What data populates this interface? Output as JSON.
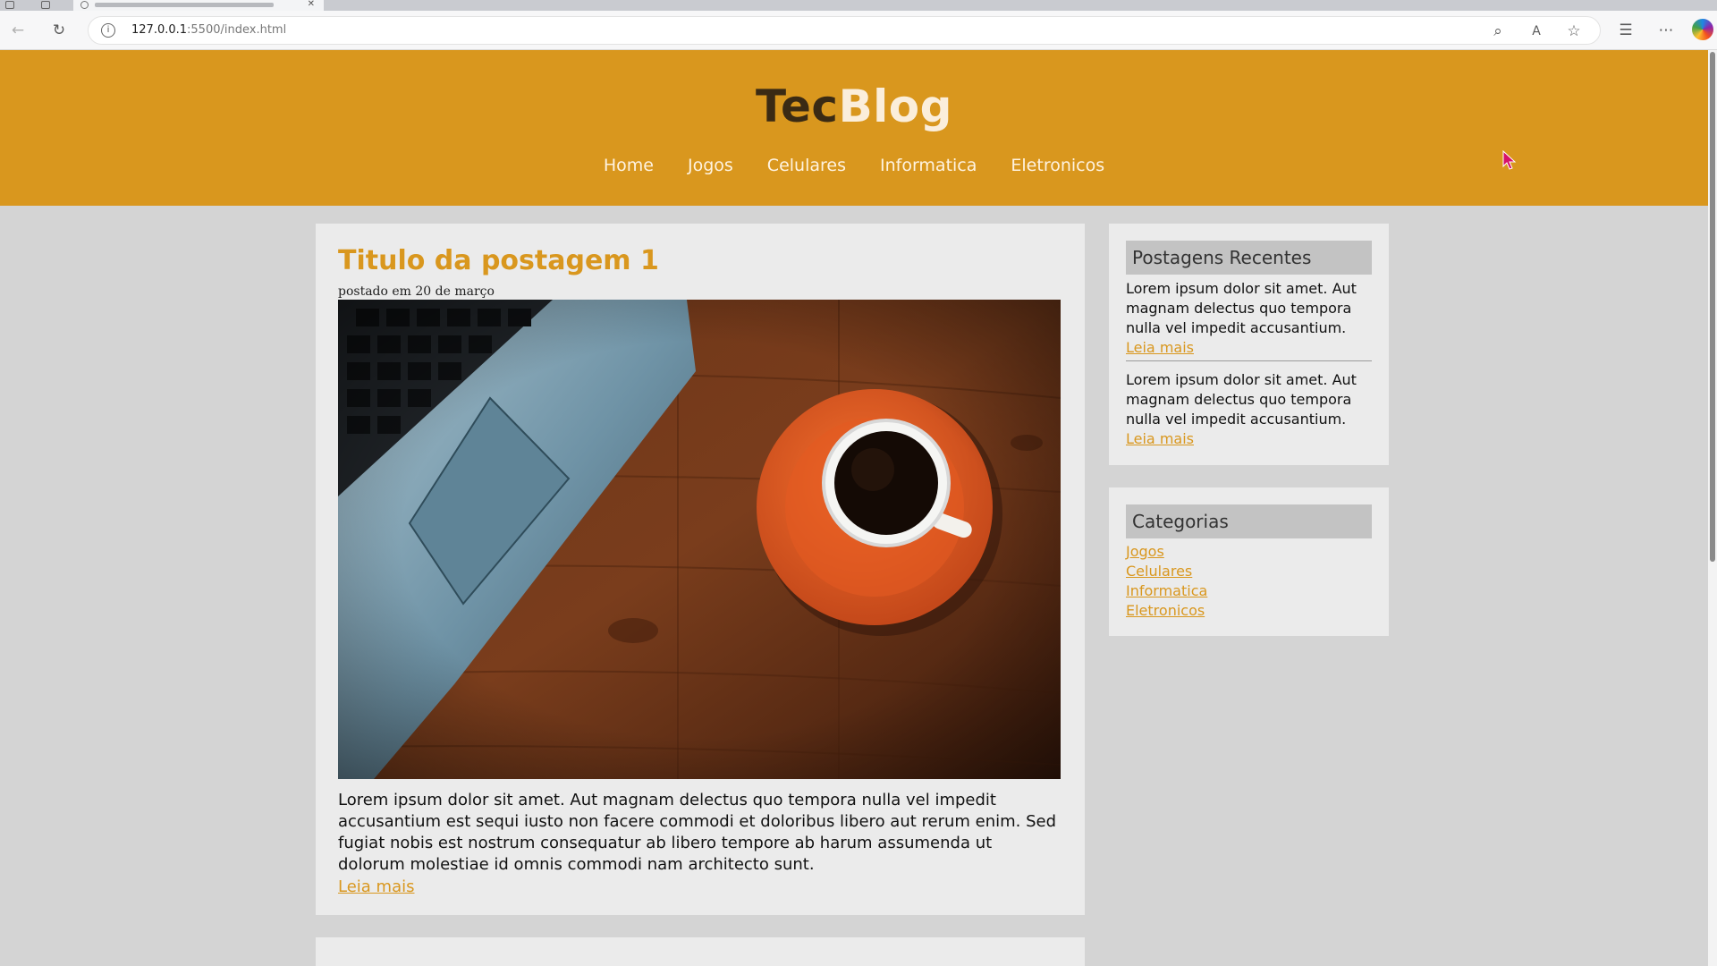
{
  "browser": {
    "url_host": "127.0.0.1",
    "url_path": ":5500/index.html",
    "back_icon": "arrow-left-icon",
    "reload_icon": "reload-icon"
  },
  "site": {
    "logo_part1": "Tec",
    "logo_part2": "Blog",
    "accent_color": "#d9971e",
    "nav": [
      "Home",
      "Jogos",
      "Celulares",
      "Informatica",
      "Eletronicos"
    ]
  },
  "post": {
    "title": "Titulo da postagem 1",
    "meta": "postado em 20 de março",
    "image_alt": "laptop and coffee cup on wooden desk",
    "body": "Lorem ipsum dolor sit amet. Aut magnam delectus quo tempora nulla vel impedit accusantium est sequi iusto non facere commodi et doloribus libero aut rerum enim. Sed fugiat nobis est nostrum consequatur ab libero tempore ab harum assumenda ut dolorum molestiae id omnis commodi nam architecto sunt.",
    "read_more": "Leia mais"
  },
  "sidebar": {
    "recent_title": "Postagens Recentes",
    "recent": [
      {
        "text": "Lorem ipsum dolor sit amet. Aut magnam delectus quo tempora nulla vel impedit accusantium.",
        "link": "Leia mais"
      },
      {
        "text": "Lorem ipsum dolor sit amet. Aut magnam delectus quo tempora nulla vel impedit accusantium.",
        "link": "Leia mais"
      }
    ],
    "categories_title": "Categorias",
    "categories": [
      "Jogos",
      "Celulares",
      "Informatica",
      "Eletronicos"
    ]
  }
}
